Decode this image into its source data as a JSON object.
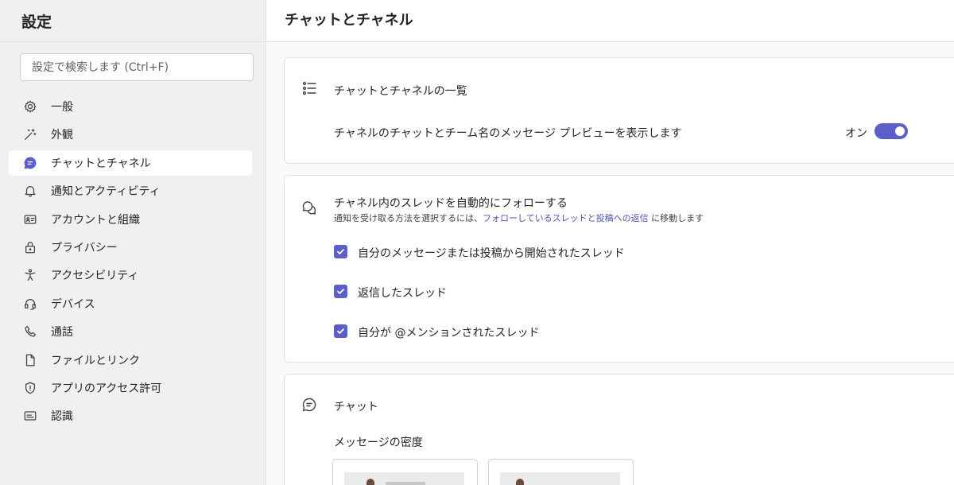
{
  "sidebar": {
    "title": "設定",
    "search_placeholder": "設定で検索します (Ctrl+F)",
    "items": [
      {
        "label": "一般",
        "icon": "gear-icon"
      },
      {
        "label": "外観",
        "icon": "magic-wand-icon"
      },
      {
        "label": "チャットとチャネル",
        "icon": "chat-icon",
        "active": true
      },
      {
        "label": "通知とアクティビティ",
        "icon": "bell-icon"
      },
      {
        "label": "アカウントと組織",
        "icon": "id-card-icon"
      },
      {
        "label": "プライバシー",
        "icon": "lock-icon"
      },
      {
        "label": "アクセシビリティ",
        "icon": "accessibility-icon"
      },
      {
        "label": "デバイス",
        "icon": "headset-icon"
      },
      {
        "label": "通話",
        "icon": "phone-icon"
      },
      {
        "label": "ファイルとリンク",
        "icon": "document-icon"
      },
      {
        "label": "アプリのアクセス許可",
        "icon": "shield-icon"
      },
      {
        "label": "認識",
        "icon": "caption-icon"
      }
    ]
  },
  "main": {
    "title": "チャットとチャネル",
    "list_card": {
      "title": "チャットとチャネルの一覧",
      "setting_label": "チャネルのチャットとチーム名のメッセージ プレビューを表示します",
      "toggle_state": "オン"
    },
    "follow_card": {
      "title": "チャネル内のスレッドを自動的にフォローする",
      "subtitle_prefix": "通知を受け取る方法を選択するには、",
      "subtitle_link": "フォローしているスレッドと投稿への返信",
      "subtitle_suffix": " に移動します",
      "options": [
        {
          "label": "自分のメッセージまたは投稿から開始されたスレッド",
          "checked": true
        },
        {
          "label": "返信したスレッド",
          "checked": true
        },
        {
          "label": "自分が @メンションされたスレッド",
          "checked": true
        }
      ]
    },
    "chat_card": {
      "title": "チャット",
      "density_label": "メッセージの密度"
    }
  },
  "colors": {
    "accent": "#5b5fc7",
    "link": "#4f52b2",
    "sidebar_bg": "#f0f0f0"
  }
}
